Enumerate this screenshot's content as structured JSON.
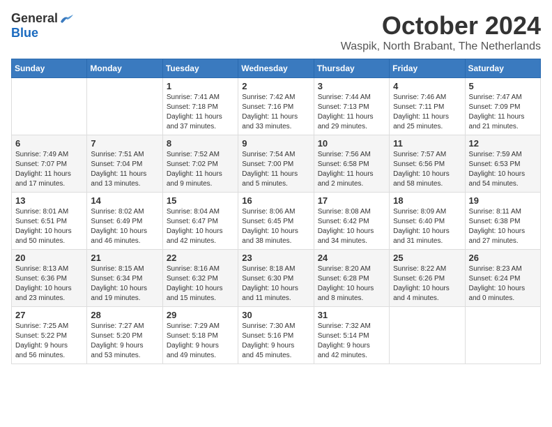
{
  "logo": {
    "general": "General",
    "blue": "Blue"
  },
  "title": "October 2024",
  "location": "Waspik, North Brabant, The Netherlands",
  "headers": [
    "Sunday",
    "Monday",
    "Tuesday",
    "Wednesday",
    "Thursday",
    "Friday",
    "Saturday"
  ],
  "weeks": [
    [
      {
        "day": "",
        "info": ""
      },
      {
        "day": "",
        "info": ""
      },
      {
        "day": "1",
        "info": "Sunrise: 7:41 AM\nSunset: 7:18 PM\nDaylight: 11 hours\nand 37 minutes."
      },
      {
        "day": "2",
        "info": "Sunrise: 7:42 AM\nSunset: 7:16 PM\nDaylight: 11 hours\nand 33 minutes."
      },
      {
        "day": "3",
        "info": "Sunrise: 7:44 AM\nSunset: 7:13 PM\nDaylight: 11 hours\nand 29 minutes."
      },
      {
        "day": "4",
        "info": "Sunrise: 7:46 AM\nSunset: 7:11 PM\nDaylight: 11 hours\nand 25 minutes."
      },
      {
        "day": "5",
        "info": "Sunrise: 7:47 AM\nSunset: 7:09 PM\nDaylight: 11 hours\nand 21 minutes."
      }
    ],
    [
      {
        "day": "6",
        "info": "Sunrise: 7:49 AM\nSunset: 7:07 PM\nDaylight: 11 hours\nand 17 minutes."
      },
      {
        "day": "7",
        "info": "Sunrise: 7:51 AM\nSunset: 7:04 PM\nDaylight: 11 hours\nand 13 minutes."
      },
      {
        "day": "8",
        "info": "Sunrise: 7:52 AM\nSunset: 7:02 PM\nDaylight: 11 hours\nand 9 minutes."
      },
      {
        "day": "9",
        "info": "Sunrise: 7:54 AM\nSunset: 7:00 PM\nDaylight: 11 hours\nand 5 minutes."
      },
      {
        "day": "10",
        "info": "Sunrise: 7:56 AM\nSunset: 6:58 PM\nDaylight: 11 hours\nand 2 minutes."
      },
      {
        "day": "11",
        "info": "Sunrise: 7:57 AM\nSunset: 6:56 PM\nDaylight: 10 hours\nand 58 minutes."
      },
      {
        "day": "12",
        "info": "Sunrise: 7:59 AM\nSunset: 6:53 PM\nDaylight: 10 hours\nand 54 minutes."
      }
    ],
    [
      {
        "day": "13",
        "info": "Sunrise: 8:01 AM\nSunset: 6:51 PM\nDaylight: 10 hours\nand 50 minutes."
      },
      {
        "day": "14",
        "info": "Sunrise: 8:02 AM\nSunset: 6:49 PM\nDaylight: 10 hours\nand 46 minutes."
      },
      {
        "day": "15",
        "info": "Sunrise: 8:04 AM\nSunset: 6:47 PM\nDaylight: 10 hours\nand 42 minutes."
      },
      {
        "day": "16",
        "info": "Sunrise: 8:06 AM\nSunset: 6:45 PM\nDaylight: 10 hours\nand 38 minutes."
      },
      {
        "day": "17",
        "info": "Sunrise: 8:08 AM\nSunset: 6:42 PM\nDaylight: 10 hours\nand 34 minutes."
      },
      {
        "day": "18",
        "info": "Sunrise: 8:09 AM\nSunset: 6:40 PM\nDaylight: 10 hours\nand 31 minutes."
      },
      {
        "day": "19",
        "info": "Sunrise: 8:11 AM\nSunset: 6:38 PM\nDaylight: 10 hours\nand 27 minutes."
      }
    ],
    [
      {
        "day": "20",
        "info": "Sunrise: 8:13 AM\nSunset: 6:36 PM\nDaylight: 10 hours\nand 23 minutes."
      },
      {
        "day": "21",
        "info": "Sunrise: 8:15 AM\nSunset: 6:34 PM\nDaylight: 10 hours\nand 19 minutes."
      },
      {
        "day": "22",
        "info": "Sunrise: 8:16 AM\nSunset: 6:32 PM\nDaylight: 10 hours\nand 15 minutes."
      },
      {
        "day": "23",
        "info": "Sunrise: 8:18 AM\nSunset: 6:30 PM\nDaylight: 10 hours\nand 11 minutes."
      },
      {
        "day": "24",
        "info": "Sunrise: 8:20 AM\nSunset: 6:28 PM\nDaylight: 10 hours\nand 8 minutes."
      },
      {
        "day": "25",
        "info": "Sunrise: 8:22 AM\nSunset: 6:26 PM\nDaylight: 10 hours\nand 4 minutes."
      },
      {
        "day": "26",
        "info": "Sunrise: 8:23 AM\nSunset: 6:24 PM\nDaylight: 10 hours\nand 0 minutes."
      }
    ],
    [
      {
        "day": "27",
        "info": "Sunrise: 7:25 AM\nSunset: 5:22 PM\nDaylight: 9 hours\nand 56 minutes."
      },
      {
        "day": "28",
        "info": "Sunrise: 7:27 AM\nSunset: 5:20 PM\nDaylight: 9 hours\nand 53 minutes."
      },
      {
        "day": "29",
        "info": "Sunrise: 7:29 AM\nSunset: 5:18 PM\nDaylight: 9 hours\nand 49 minutes."
      },
      {
        "day": "30",
        "info": "Sunrise: 7:30 AM\nSunset: 5:16 PM\nDaylight: 9 hours\nand 45 minutes."
      },
      {
        "day": "31",
        "info": "Sunrise: 7:32 AM\nSunset: 5:14 PM\nDaylight: 9 hours\nand 42 minutes."
      },
      {
        "day": "",
        "info": ""
      },
      {
        "day": "",
        "info": ""
      }
    ]
  ]
}
